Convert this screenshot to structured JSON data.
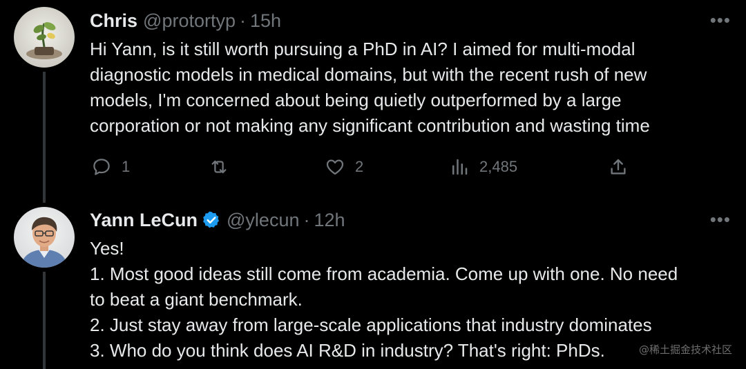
{
  "tweets": [
    {
      "name": "Chris",
      "handle": "@protortyp",
      "separator": "·",
      "time": "15h",
      "more": "•••",
      "text": "Hi Yann, is it still worth pursuing a PhD in AI? I aimed for multi-modal\ndiagnostic models in medical domains, but with the recent rush of new\nmodels, I'm concerned about being quietly outperformed by a large\ncorporation or not making any significant contribution and wasting time",
      "actions": {
        "reply_icon": "reply-icon",
        "reply_count": "1",
        "retweet_icon": "retweet-icon",
        "retweet_count": "",
        "like_icon": "heart-icon",
        "like_count": "2",
        "views_icon": "views-icon",
        "views_count": "2,485",
        "share_icon": "share-icon"
      }
    },
    {
      "name": "Yann LeCun",
      "verified": true,
      "handle": "@ylecun",
      "separator": "·",
      "time": "12h",
      "more": "•••",
      "text": "Yes!\n1. Most good ideas still come from academia. Come up with one. No need\nto beat a giant benchmark.\n2. Just stay away from large-scale applications that industry dominates\n3. Who do you think does AI R&D in industry? That's right: PhDs."
    }
  ],
  "watermark": "@稀土掘金技术社区",
  "colors": {
    "background": "#000000",
    "primary_text": "#e7e9ea",
    "secondary_text": "#71767b",
    "verified": "#1d9bf0",
    "thread_line": "#333639"
  }
}
